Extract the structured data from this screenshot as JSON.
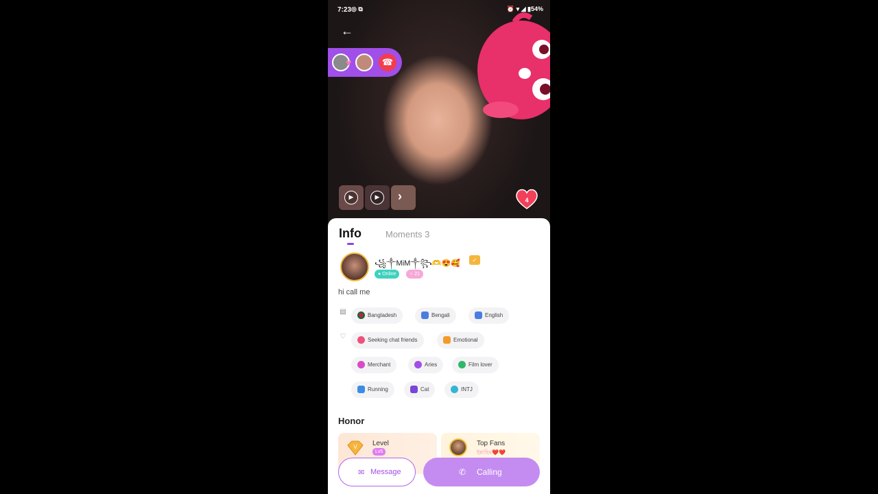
{
  "status_bar": {
    "time": "7:23",
    "left_icons": "◎ ⧉",
    "battery": "54%"
  },
  "call_pill": {
    "hangup_icon": "phone-hangup-icon"
  },
  "media": {
    "like_count": "4"
  },
  "tabs": {
    "info": "Info",
    "moments": "Moments 3"
  },
  "profile": {
    "nickname": "꧁༒MiM༒꧂🫶😍🥰",
    "status": "Online",
    "age": "21",
    "bio": "hi call me"
  },
  "basic_tags": [
    {
      "label": "Bangladesh",
      "color": "#c0233a"
    },
    {
      "label": "Bengali",
      "color": "#4a7de0"
    },
    {
      "label": "English",
      "color": "#4a7de0"
    }
  ],
  "interest_tags": [
    {
      "label": "Seeking chat friends",
      "color": "#f0507a"
    },
    {
      "label": "Emotional",
      "color": "#f59a2a"
    },
    {
      "label": "Merchant",
      "color": "#d64cc8"
    },
    {
      "label": "Aries",
      "color": "#a24fe6"
    },
    {
      "label": "Film lover",
      "color": "#2fb86a"
    },
    {
      "label": "Running",
      "color": "#3a8de6"
    },
    {
      "label": "Cat",
      "color": "#7a46d8"
    },
    {
      "label": "INTJ",
      "color": "#33b5d6"
    }
  ],
  "honor": {
    "title": "Honor",
    "level_label": "Level",
    "level_value": "Lv5",
    "fans_label": "Top Fans",
    "fans_sub": "ইন্নাহিম❤️❤️"
  },
  "actions": {
    "message": "Message",
    "calling": "Calling"
  },
  "colors": {
    "accent": "#a24fe6",
    "calling_button": "#c48cf0",
    "hangup": "#f23c50"
  }
}
